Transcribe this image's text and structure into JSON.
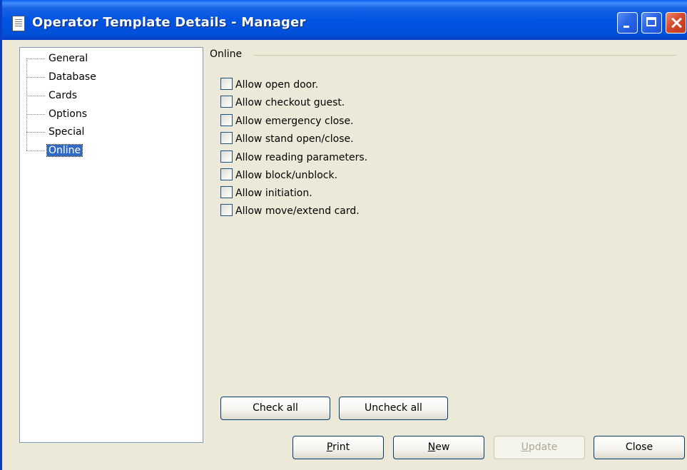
{
  "window": {
    "title": "Operator Template Details - Manager",
    "colors": {
      "titlebar": "#0054E3",
      "face": "#ECE9D8",
      "selection": "#316AC5"
    }
  },
  "tree": {
    "items": [
      {
        "label": "General",
        "selected": false
      },
      {
        "label": "Database",
        "selected": false
      },
      {
        "label": "Cards",
        "selected": false
      },
      {
        "label": "Options",
        "selected": false
      },
      {
        "label": "Special",
        "selected": false
      },
      {
        "label": "Online",
        "selected": true
      }
    ]
  },
  "group": {
    "label": "Online",
    "checkboxes": [
      {
        "label": "Allow open door.",
        "checked": false
      },
      {
        "label": "Allow checkout guest.",
        "checked": false
      },
      {
        "label": "Allow emergency close.",
        "checked": false
      },
      {
        "label": "Allow stand open/close.",
        "checked": false
      },
      {
        "label": "Allow reading parameters.",
        "checked": false
      },
      {
        "label": "Allow block/unblock.",
        "checked": false
      },
      {
        "label": "Allow initiation.",
        "checked": false
      },
      {
        "label": "Allow move/extend card.",
        "checked": false
      }
    ]
  },
  "buttons": {
    "check_all": "Check all",
    "uncheck_all": "Uncheck all",
    "print": {
      "mnemonic": "P",
      "rest": "rint"
    },
    "new": {
      "mnemonic": "N",
      "rest": "ew"
    },
    "update": {
      "mnemonic": "U",
      "rest": "pdate",
      "disabled": true
    },
    "close": "Close"
  },
  "icons": {
    "title": "document-icon",
    "minimize": "minimize-icon",
    "maximize": "maximize-icon",
    "close": "close-icon"
  }
}
